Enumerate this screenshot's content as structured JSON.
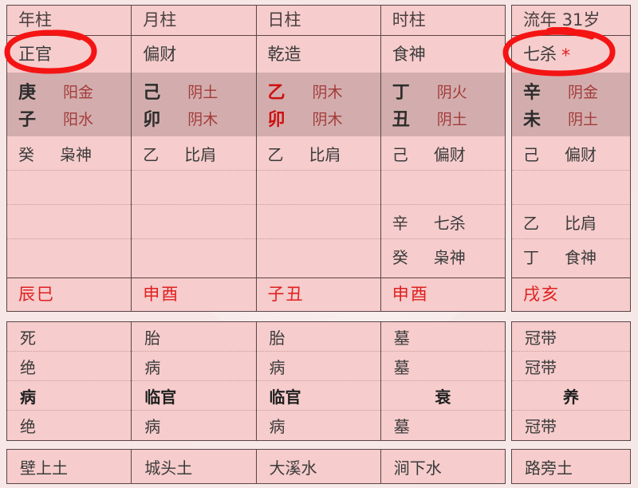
{
  "columns": [
    {
      "header": "年柱",
      "ten_god": "正官",
      "ten_god_circled": true,
      "stem": "庚",
      "stem_element": "阳金",
      "branch": "子",
      "branch_element": "阳水",
      "is_daymaster": false,
      "hidden_stems": [
        {
          "stem": "癸",
          "god": "枭神"
        },
        {
          "stem": "",
          "god": ""
        },
        {
          "stem": "",
          "god": ""
        },
        {
          "stem": "",
          "god": ""
        }
      ],
      "void": "辰巳",
      "stages": [
        {
          "text": "死",
          "emph": false
        },
        {
          "text": "绝",
          "emph": false
        },
        {
          "text": "病",
          "emph": true
        },
        {
          "text": "绝",
          "emph": false
        }
      ],
      "nayin": "壁上土"
    },
    {
      "header": "月柱",
      "ten_god": "偏财",
      "ten_god_circled": false,
      "stem": "己",
      "stem_element": "阴土",
      "branch": "卯",
      "branch_element": "阴木",
      "is_daymaster": false,
      "hidden_stems": [
        {
          "stem": "乙",
          "god": "比肩"
        },
        {
          "stem": "",
          "god": ""
        },
        {
          "stem": "",
          "god": ""
        },
        {
          "stem": "",
          "god": ""
        }
      ],
      "void": "申酉",
      "stages": [
        {
          "text": "胎",
          "emph": false
        },
        {
          "text": "病",
          "emph": false
        },
        {
          "text": "临官",
          "emph": true
        },
        {
          "text": "病",
          "emph": false
        }
      ],
      "nayin": "城头土"
    },
    {
      "header": "日柱",
      "ten_god": "乾造",
      "ten_god_circled": false,
      "stem": "乙",
      "stem_element": "阴木",
      "branch": "卯",
      "branch_element": "阴木",
      "is_daymaster": true,
      "hidden_stems": [
        {
          "stem": "乙",
          "god": "比肩"
        },
        {
          "stem": "",
          "god": ""
        },
        {
          "stem": "",
          "god": ""
        },
        {
          "stem": "",
          "god": ""
        }
      ],
      "void": "子丑",
      "stages": [
        {
          "text": "胎",
          "emph": false
        },
        {
          "text": "病",
          "emph": false
        },
        {
          "text": "临官",
          "emph": true
        },
        {
          "text": "病",
          "emph": false
        }
      ],
      "nayin": "大溪水"
    },
    {
      "header": "时柱",
      "ten_god": "食神",
      "ten_god_circled": false,
      "stem": "丁",
      "stem_element": "阴火",
      "branch": "丑",
      "branch_element": "阴土",
      "is_daymaster": false,
      "hidden_stems": [
        {
          "stem": "己",
          "god": "偏财"
        },
        {
          "stem": "",
          "god": ""
        },
        {
          "stem": "辛",
          "god": "七杀"
        },
        {
          "stem": "癸",
          "god": "枭神"
        }
      ],
      "void": "申酉",
      "stages": [
        {
          "text": "墓",
          "emph": false
        },
        {
          "text": "墓",
          "emph": false
        },
        {
          "text": "衰",
          "emph": true
        },
        {
          "text": "墓",
          "emph": false
        }
      ],
      "nayin": "涧下水"
    }
  ],
  "liunian": {
    "header": "流年 31岁",
    "ten_god": "七杀",
    "ten_god_marker": "*",
    "ten_god_circled": true,
    "stem": "辛",
    "stem_element": "阴金",
    "branch": "未",
    "branch_element": "阴土",
    "hidden_stems": [
      {
        "stem": "己",
        "god": "偏财"
      },
      {
        "stem": "",
        "god": ""
      },
      {
        "stem": "乙",
        "god": "比肩"
      },
      {
        "stem": "丁",
        "god": "食神"
      }
    ],
    "void": "戌亥",
    "stages": [
      {
        "text": "冠带",
        "emph": false
      },
      {
        "text": "冠带",
        "emph": false
      },
      {
        "text": "养",
        "emph": true
      },
      {
        "text": "冠带",
        "emph": false
      }
    ],
    "nayin": "路旁土"
  },
  "colors": {
    "page_background": "#f7e6e6",
    "cell_background": "#f6cccc",
    "band_background": "#d3adad",
    "border": "#5a4545",
    "element_text": "#a33b3b",
    "void_text": "#e02020",
    "daymaster_text": "#cc1111",
    "annotation_red": "#f41414"
  }
}
